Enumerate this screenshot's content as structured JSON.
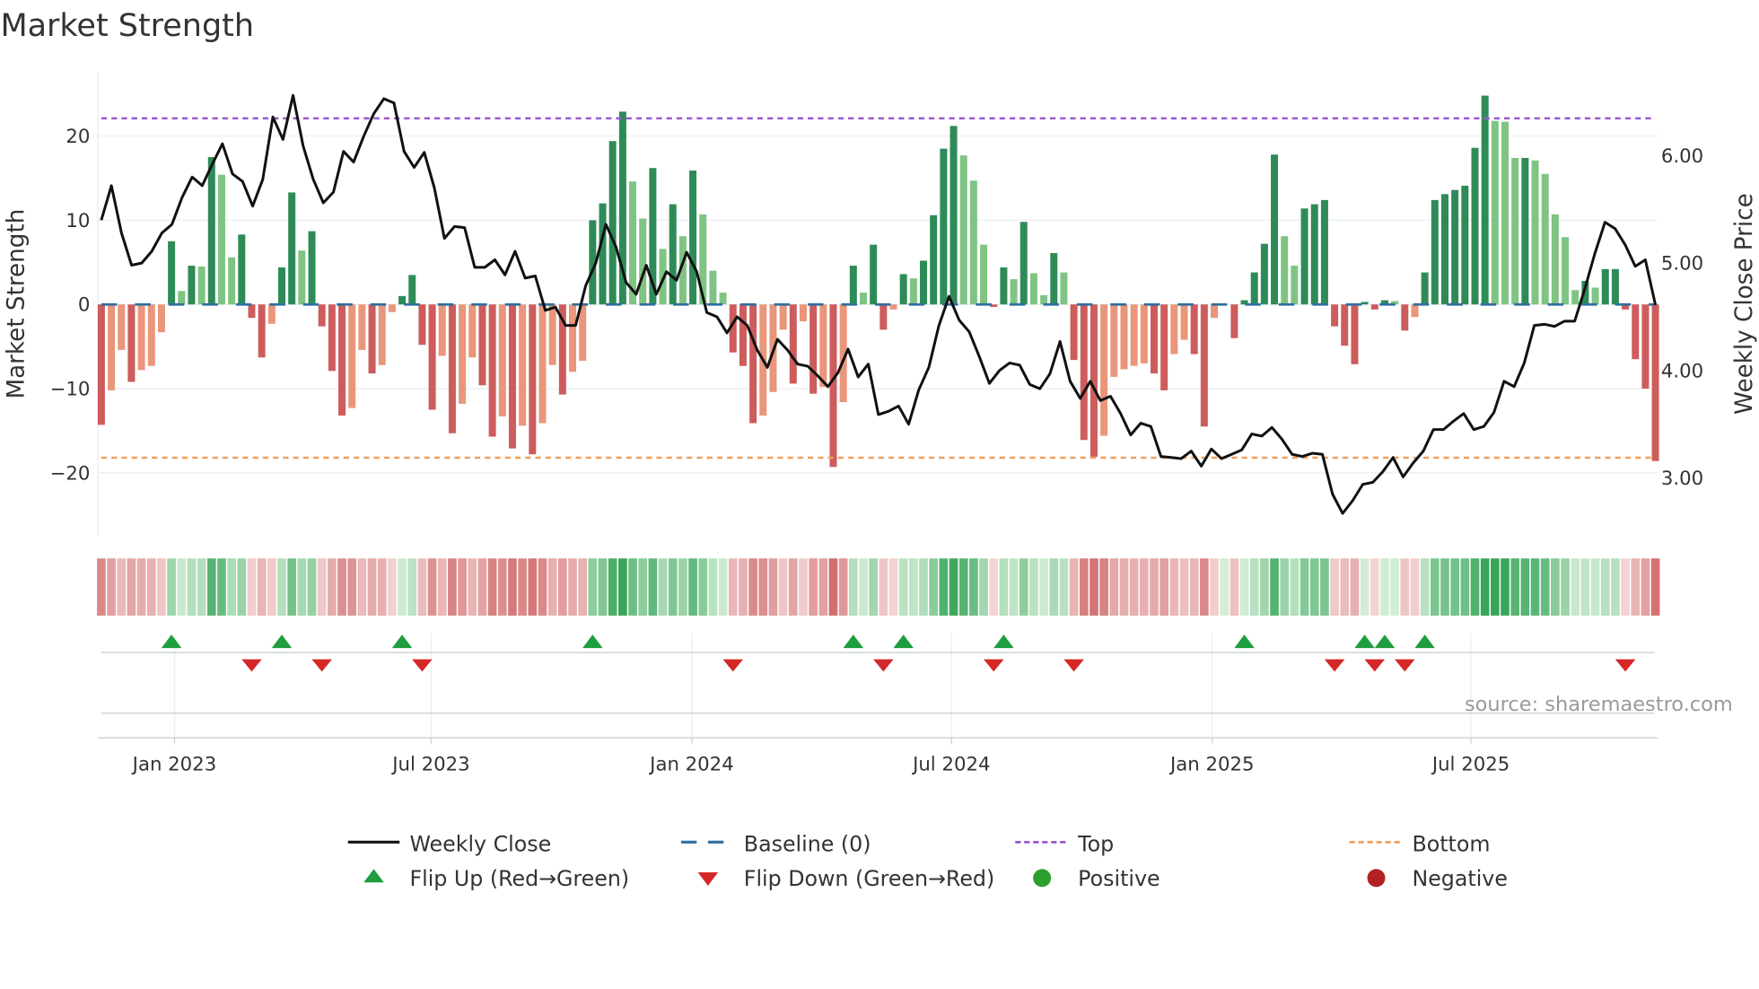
{
  "title": "Market Strength",
  "source": "source: sharemaestro.com",
  "colors": {
    "strong_positive": "#2e8b57",
    "weak_positive": "#80c483",
    "strong_negative": "#cd5c5c",
    "weak_negative": "#e9967a",
    "close_line": "#111111",
    "baseline": "#2f6f9f",
    "top": "#9b59d0",
    "bottom": "#f0a060",
    "flip_up": "#1e9e3e",
    "flip_down": "#d62728",
    "positive": "#2ca02c",
    "negative": "#b22222"
  },
  "legend": {
    "weekly_close": "Weekly Close",
    "baseline": "Baseline (0)",
    "top": "Top",
    "bottom": "Bottom",
    "flip_up": "Flip Up (Red→Green)",
    "flip_down": "Flip Down (Green→Red)",
    "positive": "Positive",
    "negative": "Negative"
  },
  "chart_data": {
    "type": "bar",
    "title": "Market Strength",
    "ylabel": "Market Strength",
    "ylabel_right": "Weekly Close Price",
    "ylim": [
      -27.5,
      27.5
    ],
    "ylim_right": [
      2.46,
      6.77
    ],
    "yticks": [
      {
        "v": 20,
        "label": "20"
      },
      {
        "v": 10,
        "label": "10"
      },
      {
        "v": 0,
        "label": "0"
      },
      {
        "v": -10,
        "label": "−10"
      },
      {
        "v": -20,
        "label": "−20"
      }
    ],
    "yticks_right": [
      {
        "v": 6,
        "label": "6.00"
      },
      {
        "v": 5,
        "label": "5.00"
      },
      {
        "v": 4,
        "label": "4.00"
      },
      {
        "v": 3,
        "label": "3.00"
      }
    ],
    "xticks": [
      {
        "week": 7.3,
        "label": "Jan 2023"
      },
      {
        "week": 32.9,
        "label": "Jul 2023"
      },
      {
        "week": 58.9,
        "label": "Jan 2024"
      },
      {
        "week": 84.8,
        "label": "Jul 2024"
      },
      {
        "week": 110.8,
        "label": "Jan 2025"
      },
      {
        "week": 136.6,
        "label": "Jul 2025"
      }
    ],
    "top_level": 22.1,
    "bottom_level": -18.2,
    "baseline": 0,
    "strength": [
      -14.3,
      -10.2,
      -5.4,
      -9.2,
      -7.8,
      -7.3,
      -3.3,
      7.5,
      1.6,
      4.6,
      4.5,
      17.5,
      15.4,
      5.6,
      8.3,
      -1.6,
      -6.3,
      -2.3,
      4.4,
      13.3,
      6.4,
      8.7,
      -2.6,
      -7.9,
      -13.2,
      -12.3,
      -5.4,
      -8.2,
      -7.2,
      -0.9,
      1,
      3.5,
      -4.8,
      -12.5,
      -6.1,
      -15.3,
      -11.8,
      -6.3,
      -9.6,
      -15.7,
      -13.3,
      -17.1,
      -14.4,
      -17.8,
      -14.1,
      -7.2,
      -10.7,
      -8,
      -6.7,
      10,
      12,
      19.4,
      22.9,
      14.6,
      10.2,
      16.2,
      6.6,
      11.9,
      8.1,
      15.9,
      10.7,
      4,
      1.4,
      -5.7,
      -7.3,
      -14.1,
      -13.2,
      -10.4,
      -3,
      -9.4,
      -2,
      -10.6,
      -9.8,
      -19.3,
      -11.6,
      4.6,
      1.4,
      7.1,
      -3,
      -0.6,
      3.6,
      3.1,
      5.2,
      10.6,
      18.5,
      21.2,
      17.7,
      14.7,
      7.1,
      -0.3,
      4.4,
      3,
      9.8,
      3.7,
      1.1,
      6.1,
      3.8,
      -6.6,
      -16.1,
      -18.1,
      -15.6,
      -8.6,
      -7.7,
      -7.3,
      -7.0,
      -8.2,
      -10.2,
      -5.9,
      -4.2,
      -5.9,
      -14.5,
      -1.6,
      0,
      -4,
      0.5,
      3.8,
      7.2,
      17.8,
      8.1,
      4.6,
      11.4,
      11.9,
      12.4,
      -2.6,
      -4.9,
      -7.1,
      0.3,
      -0.6,
      0.5,
      0.4,
      -3.1,
      -1.5,
      3.8,
      12.4,
      13.1,
      13.6,
      14.1,
      18.6,
      24.8,
      21.8,
      21.7,
      17.4,
      17.4,
      17.1,
      15.5,
      10.7,
      8,
      1.7,
      2.8,
      2,
      4.2,
      4.2,
      -0.6,
      -6.5,
      -10,
      -18.6
    ],
    "weekly_close": [
      5.4,
      5.72,
      5.28,
      4.98,
      5.0,
      5.11,
      5.28,
      5.36,
      5.61,
      5.8,
      5.72,
      5.92,
      6.11,
      5.83,
      5.76,
      5.53,
      5.78,
      6.36,
      6.15,
      6.56,
      6.09,
      5.78,
      5.56,
      5.66,
      6.04,
      5.94,
      6.18,
      6.39,
      6.53,
      6.49,
      6.04,
      5.89,
      6.03,
      5.7,
      5.23,
      5.34,
      5.33,
      4.96,
      4.96,
      5.03,
      4.89,
      5.11,
      4.86,
      4.88,
      4.56,
      4.59,
      4.42,
      4.42,
      4.79,
      5.0,
      5.36,
      5.15,
      4.82,
      4.71,
      4.98,
      4.71,
      4.92,
      4.84,
      5.1,
      4.92,
      4.54,
      4.5,
      4.35,
      4.5,
      4.42,
      4.19,
      4.03,
      4.29,
      4.19,
      4.06,
      4.04,
      3.95,
      3.85,
      3.98,
      4.2,
      3.94,
      4.06,
      3.59,
      3.62,
      3.67,
      3.5,
      3.82,
      4.03,
      4.42,
      4.69,
      4.47,
      4.36,
      4.13,
      3.88,
      4.0,
      4.07,
      4.05,
      3.87,
      3.83,
      3.97,
      4.27,
      3.9,
      3.74,
      3.9,
      3.72,
      3.76,
      3.6,
      3.4,
      3.51,
      3.48,
      3.2,
      3.19,
      3.18,
      3.25,
      3.11,
      3.27,
      3.18,
      3.22,
      3.26,
      3.41,
      3.39,
      3.47,
      3.36,
      3.22,
      3.2,
      3.23,
      3.22,
      2.85,
      2.67,
      2.79,
      2.94,
      2.96,
      3.06,
      3.19,
      3.01,
      3.14,
      3.25,
      3.45,
      3.45,
      3.53,
      3.6,
      3.45,
      3.48,
      3.61,
      3.9,
      3.85,
      4.07,
      4.42,
      4.43,
      4.41,
      4.46,
      4.46,
      4.76,
      5.09,
      5.38,
      5.32,
      5.17,
      4.97,
      5.03,
      4.61
    ]
  }
}
